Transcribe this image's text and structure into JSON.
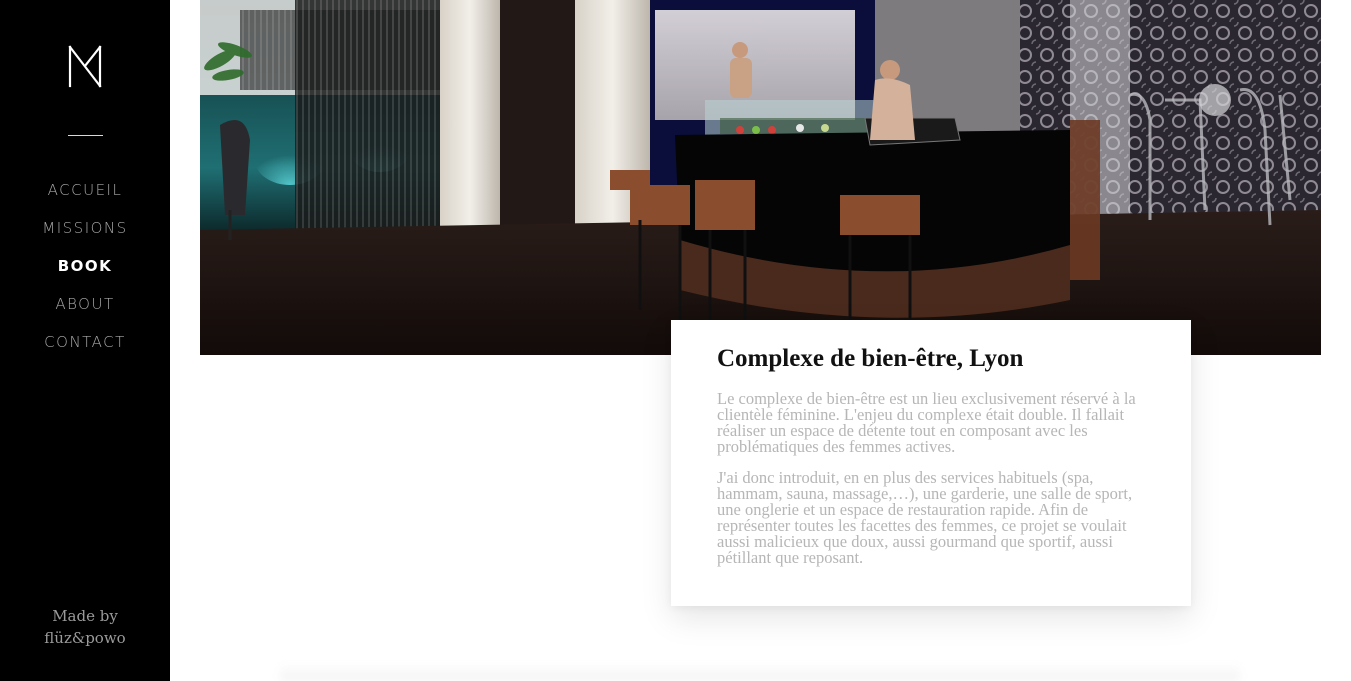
{
  "sidebar": {
    "logo_icon": "monogram-n-icon",
    "nav": [
      {
        "label": "ACCUEIL",
        "active": false
      },
      {
        "label": "MISSIONS",
        "active": false
      },
      {
        "label": "BOOK",
        "active": true
      },
      {
        "label": "ABOUT",
        "active": false
      },
      {
        "label": "CONTACT",
        "active": false
      }
    ],
    "credit_line1": "Made by",
    "credit_line2": "flüz&powo"
  },
  "project": {
    "title": "Complexe de bien-être, Lyon",
    "paragraph1": "Le complexe de bien-être est un lieu exclusivement réservé à la clientèle féminine. L'enjeu du complexe était double. Il fallait réaliser un espace de détente tout en composant avec les problématiques des femmes actives.",
    "paragraph2": "J'ai donc introduit, en en plus des services habituels (spa, hammam, sauna, massage,…), une garderie, une salle de sport, une onglerie et un espace de restauration rapide. Afin de représenter toutes les facettes des femmes, ce projet se voulait aussi malicieux que doux, aussi gourmand que sportif, aussi pétillant que reposant."
  },
  "colors": {
    "sidebar_bg": "#000000",
    "nav_inactive": "#a8a8a8",
    "nav_active": "#ffffff",
    "title": "#111111",
    "body_text": "#b6b6b6"
  }
}
